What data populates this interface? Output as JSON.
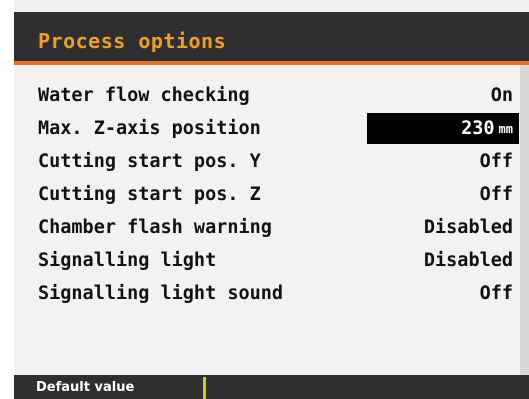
{
  "header": {
    "title": "Process options"
  },
  "settings": [
    {
      "label": "Water flow checking",
      "value": "On",
      "unit": ""
    },
    {
      "label": "Max. Z-axis position",
      "value": "230",
      "unit": "mm"
    },
    {
      "label": "Cutting start pos. Y",
      "value": "Off",
      "unit": ""
    },
    {
      "label": "Cutting start pos. Z",
      "value": "Off",
      "unit": ""
    },
    {
      "label": "Chamber flash warning",
      "value": "Disabled",
      "unit": ""
    },
    {
      "label": "Signalling light",
      "value": "Disabled",
      "unit": ""
    },
    {
      "label": "Signalling light sound",
      "value": "Off",
      "unit": ""
    }
  ],
  "footer": {
    "softkey_label": "Default value"
  },
  "colors": {
    "header_bg": "#2f2f2f",
    "title": "#f0a020",
    "accent": "#e8731c",
    "selection": "#000000",
    "softkey_divider": "#c8d400"
  }
}
